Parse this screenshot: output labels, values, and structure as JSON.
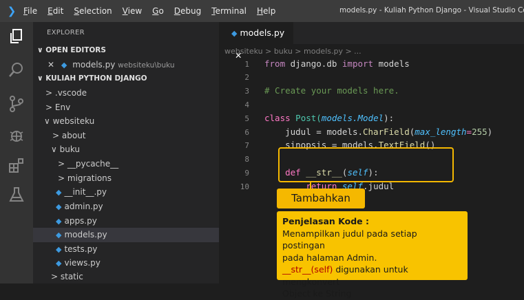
{
  "window": {
    "title": "models.py - Kuliah Python Django - Visual Studio Code",
    "menu": [
      "File",
      "Edit",
      "Selection",
      "View",
      "Go",
      "Debug",
      "Terminal",
      "Help"
    ]
  },
  "sidebar": {
    "title": "EXPLORER",
    "open_editors_header": "OPEN EDITORS",
    "open_editor_name": "models.py",
    "open_editor_path": "websiteku\\buku",
    "project_header": "KULIAH PYTHON DJANGO",
    "tree": [
      ".vscode",
      "Env",
      "websiteku",
      "about",
      "buku",
      "__pycache__",
      "migrations",
      "__init__.py",
      "admin.py",
      "apps.py",
      "models.py",
      "tests.py",
      "views.py",
      "static"
    ]
  },
  "editor": {
    "tab_label": "models.py",
    "breadcrumb": "websiteku > buku > models.py > ...",
    "line_numbers": [
      "1",
      "2",
      "3",
      "4",
      "5",
      "6",
      "7",
      "8",
      "9",
      "10"
    ],
    "code": {
      "l1_kw1": "from",
      "l1_mod": "django.db",
      "l1_kw2": "import",
      "l1_name": "models",
      "l3": "# Create your models here.",
      "l5_kw": "class",
      "l5_name": "Post(",
      "l5_base1": "models",
      "l5_base2": ".Model",
      "l5_end": "):",
      "l6_a": "judul = models.",
      "l6_fn": "CharField",
      "l6_b": "(",
      "l6_arg": "max_length",
      "l6_eq": "=",
      "l6_num": "255",
      "l6_c": ")",
      "l7_a": "sinopsis = models.",
      "l7_fn": "TextField",
      "l7_b": "()",
      "l9_kw": "def",
      "l9_fn": "__str__",
      "l9_a": "(",
      "l9_self": "self",
      "l9_b": "):",
      "l10_kw": "return",
      "l10_self": "self",
      "l10_attr": ".judul"
    }
  },
  "callout": {
    "label": "Tambahkan",
    "heading": "Penjelasan Kode :",
    "line1": "Menampilkan judul pada setiap postingan",
    "line2": "pada halaman Admin.",
    "line3_red": "__str__(self)",
    "line3_rest": " digunakan untuk mengkonvert",
    "line4": "Object ke String"
  },
  "colors": {
    "accent": "#f5b800",
    "editor_bg": "#1e1e1e",
    "sidebar_bg": "#252526"
  }
}
